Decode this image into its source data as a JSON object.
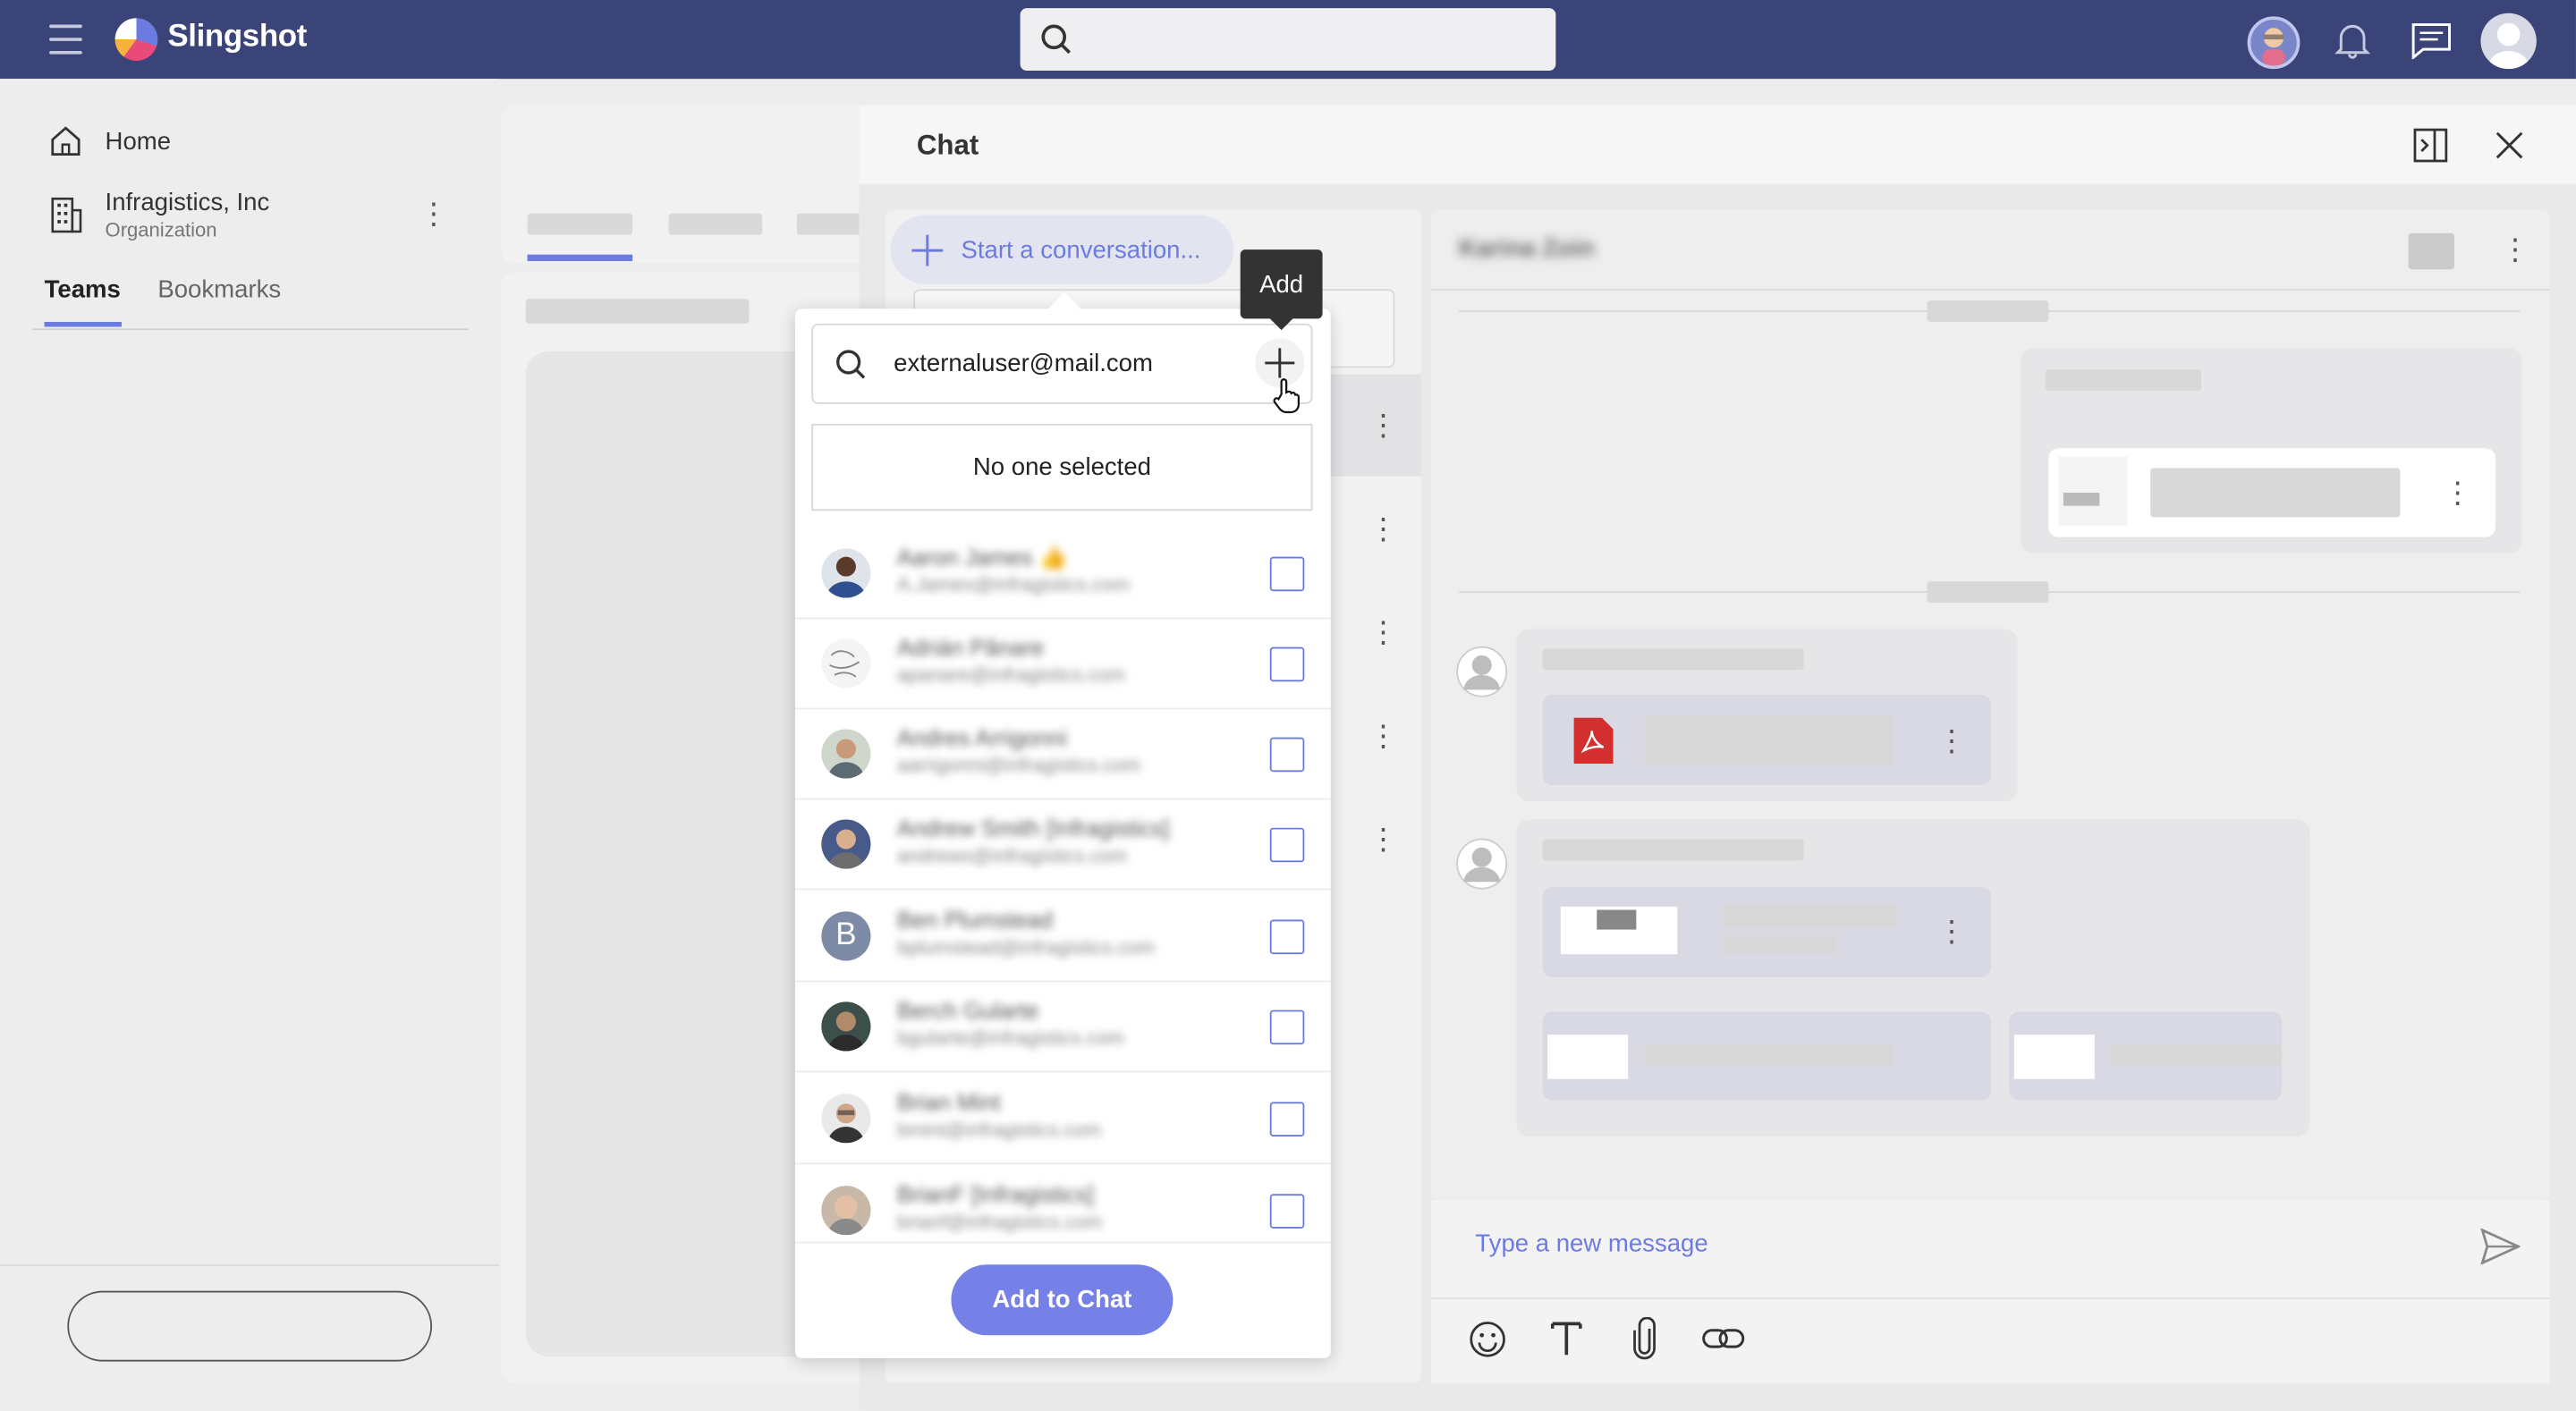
{
  "app": {
    "name": "Slingshot"
  },
  "colors": {
    "topbar": "#3a4478",
    "accent": "#6c7be0",
    "add_button": "#7581e6"
  },
  "nav": {
    "home_label": "Home",
    "org_name": "Infragistics, Inc",
    "org_type": "Organization",
    "tabs": [
      {
        "label": "Teams",
        "active": true
      },
      {
        "label": "Bookmarks",
        "active": false
      }
    ]
  },
  "chat": {
    "title": "Chat",
    "start_conversation": "Start a conversation...",
    "conversation_name": "Karina Zoin",
    "message_placeholder": "Type a new message"
  },
  "add_people": {
    "tooltip": "Add",
    "search_value": "externaluser@mail.com",
    "selection_status": "No one selected",
    "contacts": [
      {
        "name": "Aaron James 👍",
        "email": "A.James@infragistics.com",
        "avatar": "photo"
      },
      {
        "name": "Adrián Pânare",
        "email": "apanare@infragistics.com",
        "avatar": "sketch"
      },
      {
        "name": "Andres Arrigonni",
        "email": "aarrigonni@infragistics.com",
        "avatar": "photo"
      },
      {
        "name": "Andrew Smith [Infragistics]",
        "email": "andrews@infragistics.com",
        "avatar": "photo"
      },
      {
        "name": "Ben Plumstead",
        "email": "bplumstead@infragistics.com",
        "avatar": "initial",
        "initial": "B"
      },
      {
        "name": "Berch Gularte",
        "email": "bgularte@infragistics.com",
        "avatar": "photo"
      },
      {
        "name": "Brian Mint",
        "email": "bmint@infragistics.com",
        "avatar": "photo"
      },
      {
        "name": "BrianF [Infragistics]",
        "email": "brianf@infragistics.com",
        "avatar": "photo"
      }
    ],
    "add_button": "Add to Chat"
  }
}
